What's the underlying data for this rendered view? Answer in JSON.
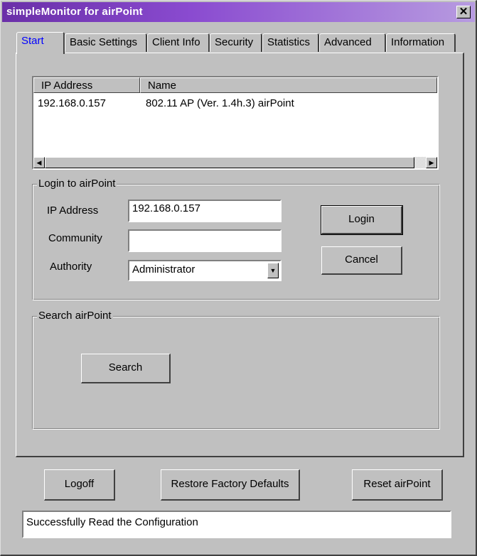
{
  "window": {
    "title": "simpleMonitor for airPoint",
    "close_label": "✕"
  },
  "tabs": [
    {
      "label": "Start",
      "active": true
    },
    {
      "label": "Basic Settings"
    },
    {
      "label": "Client Info"
    },
    {
      "label": "Security"
    },
    {
      "label": "Statistics"
    },
    {
      "label": "Advanced"
    },
    {
      "label": "Information"
    }
  ],
  "device_list": {
    "columns": [
      "IP Address",
      "Name"
    ],
    "rows": [
      {
        "ip": "192.168.0.157",
        "name": "802.11 AP (Ver. 1.4h.3) airPoint"
      }
    ]
  },
  "login": {
    "group_label": "Login to airPoint",
    "ip_label": "IP Address",
    "ip_value": "192.168.0.157",
    "community_label": "Community",
    "community_value": "",
    "authority_label": "Authority",
    "authority_value": "Administrator",
    "login_button": "Login",
    "cancel_button": "Cancel"
  },
  "search": {
    "group_label": "Search airPoint",
    "search_button": "Search"
  },
  "footer": {
    "logoff_button": "Logoff",
    "restore_button": "Restore Factory Defaults",
    "reset_button": "Reset airPoint"
  },
  "status": {
    "message": "Successfully Read the Configuration"
  },
  "icons": {
    "scroll_left": "◀",
    "scroll_right": "▶",
    "dropdown": "▼"
  }
}
